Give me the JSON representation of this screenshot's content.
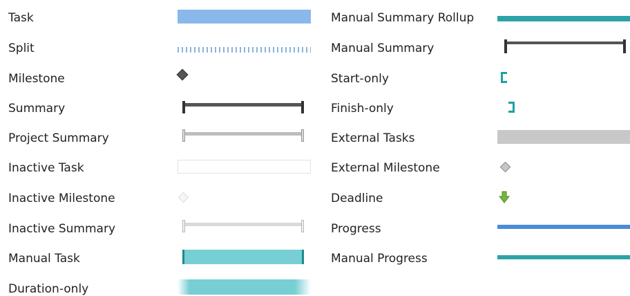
{
  "legend": {
    "left": [
      {
        "label": "Task",
        "symbol": "task-bar"
      },
      {
        "label": "Split",
        "symbol": "split-bar"
      },
      {
        "label": "Milestone",
        "symbol": "milestone-diamond"
      },
      {
        "label": "Summary",
        "symbol": "summary-bar"
      },
      {
        "label": "Project Summary",
        "symbol": "project-summary-bar"
      },
      {
        "label": "Inactive Task",
        "symbol": "inactive-task-bar"
      },
      {
        "label": "Inactive Milestone",
        "symbol": "inactive-milestone-diamond"
      },
      {
        "label": "Inactive Summary",
        "symbol": "inactive-summary-bar"
      },
      {
        "label": "Manual Task",
        "symbol": "manual-task-bar"
      },
      {
        "label": "Duration-only",
        "symbol": "duration-only-bar"
      }
    ],
    "right": [
      {
        "label": "Manual Summary Rollup",
        "symbol": "manual-summary-rollup-bar"
      },
      {
        "label": "Manual Summary",
        "symbol": "manual-summary-bar"
      },
      {
        "label": "Start-only",
        "symbol": "start-only-bracket"
      },
      {
        "label": "Finish-only",
        "symbol": "finish-only-bracket"
      },
      {
        "label": "External Tasks",
        "symbol": "external-tasks-bar"
      },
      {
        "label": "External Milestone",
        "symbol": "external-milestone-diamond"
      },
      {
        "label": "Deadline",
        "symbol": "deadline-arrow"
      },
      {
        "label": "Progress",
        "symbol": "progress-bar"
      },
      {
        "label": "Manual Progress",
        "symbol": "manual-progress-bar"
      }
    ]
  },
  "colors": {
    "task": "#8ab8ea",
    "split": "#8ab4d8",
    "milestone": "#555555",
    "summary": "#555555",
    "project_summary": "#bdbdbd",
    "inactive_task_border": "#e3e3e3",
    "inactive_milestone": "#e0e0e0",
    "inactive_summary": "#d9d9d9",
    "manual_task": "#77ced3",
    "manual_task_edge": "#1b8a90",
    "manual_summary_rollup": "#2da3a8",
    "manual_summary": "#555555",
    "start_finish_bracket": "#1e9fa5",
    "external_tasks": "#c8c8c8",
    "external_milestone": "#c6c6c6",
    "deadline": "#73b63b",
    "progress": "#4a8cd6",
    "manual_progress": "#2da3a8"
  }
}
